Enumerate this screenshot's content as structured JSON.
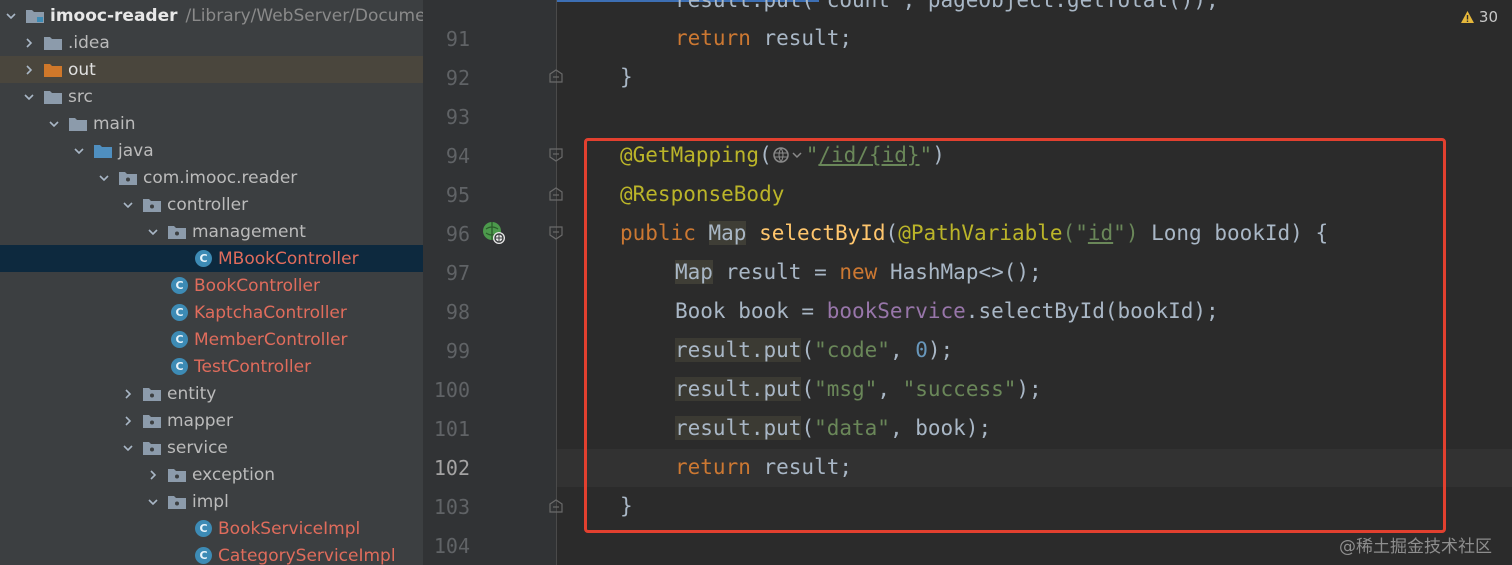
{
  "project": {
    "root_name": "imooc-reader",
    "root_path": "/Library/WebServer/Document",
    "items": [
      {
        "label": ".idea",
        "icon": "folder-icon"
      },
      {
        "label": "out",
        "icon": "folder-orange-icon"
      },
      {
        "label": "src",
        "icon": "folder-icon"
      },
      {
        "label": "main",
        "icon": "folder-icon"
      },
      {
        "label": "java",
        "icon": "source-folder-icon"
      },
      {
        "label": "com.imooc.reader",
        "icon": "package-icon"
      },
      {
        "label": "controller",
        "icon": "package-icon"
      },
      {
        "label": "management",
        "icon": "package-icon"
      },
      {
        "label": "MBookController",
        "icon": "class-icon"
      },
      {
        "label": "BookController",
        "icon": "class-icon"
      },
      {
        "label": "KaptchaController",
        "icon": "class-icon"
      },
      {
        "label": "MemberController",
        "icon": "class-icon"
      },
      {
        "label": "TestController",
        "icon": "class-icon"
      },
      {
        "label": "entity",
        "icon": "package-icon"
      },
      {
        "label": "mapper",
        "icon": "package-icon"
      },
      {
        "label": "service",
        "icon": "package-icon"
      },
      {
        "label": "exception",
        "icon": "package-icon"
      },
      {
        "label": "impl",
        "icon": "package-icon"
      },
      {
        "label": "BookServiceImpl",
        "icon": "class-icon"
      },
      {
        "label": "CategoryServiceImpl",
        "icon": "class-icon"
      }
    ],
    "class_glyph": "C"
  },
  "editor": {
    "line_numbers": [
      "91",
      "92",
      "93",
      "94",
      "95",
      "96",
      "97",
      "98",
      "99",
      "100",
      "101",
      "102",
      "103",
      "104"
    ],
    "warnings_count": "30",
    "top_partial": "result.put(\"count\", pageObject.getTotal());",
    "code": {
      "l91_kw": "return",
      "l91_rest": " result;",
      "l92": "}",
      "l94_ann": "@GetMapping",
      "l94_open": "(",
      "l94_str_open": "\"",
      "l94_path": "/id/{id}",
      "l94_str_close": "\"",
      "l94_close": ")",
      "l95_ann": "@ResponseBody",
      "l96_kw": "public",
      "l96_map": "Map",
      "l96_method": "selectById",
      "l96_open": "(",
      "l96_ann": "@PathVariable",
      "l96_p1": "(\"",
      "l96_id": "id",
      "l96_p2": "\")",
      "l96_rest": " Long bookId) {",
      "l97_map": "Map",
      "l97_a": " result = ",
      "l97_kw": "new",
      "l97_b": " HashMap<>();",
      "l98_a": "Book book = ",
      "l98_field": "bookService",
      "l98_b": ".selectById(bookId);",
      "l99_call": "result.put",
      "l99_open": "(",
      "l99_str": "\"code\"",
      "l99_sep": ", ",
      "l99_num": "0",
      "l99_close": ");",
      "l100_call": "result.put",
      "l100_open": "(",
      "l100_str1": "\"msg\"",
      "l100_sep": ", ",
      "l100_str2": "\"success\"",
      "l100_close": ");",
      "l101_call": "result.put",
      "l101_open": "(",
      "l101_str": "\"data\"",
      "l101_rest": ", book);",
      "l102_kw": "return",
      "l102_rest": " result;",
      "l103": "}"
    }
  },
  "watermark": "@稀土掘金技术社区",
  "colors": {
    "highlight_box": "#e2402f",
    "selected_row": "#0d293e",
    "class_icon": "#3d8bb5"
  }
}
